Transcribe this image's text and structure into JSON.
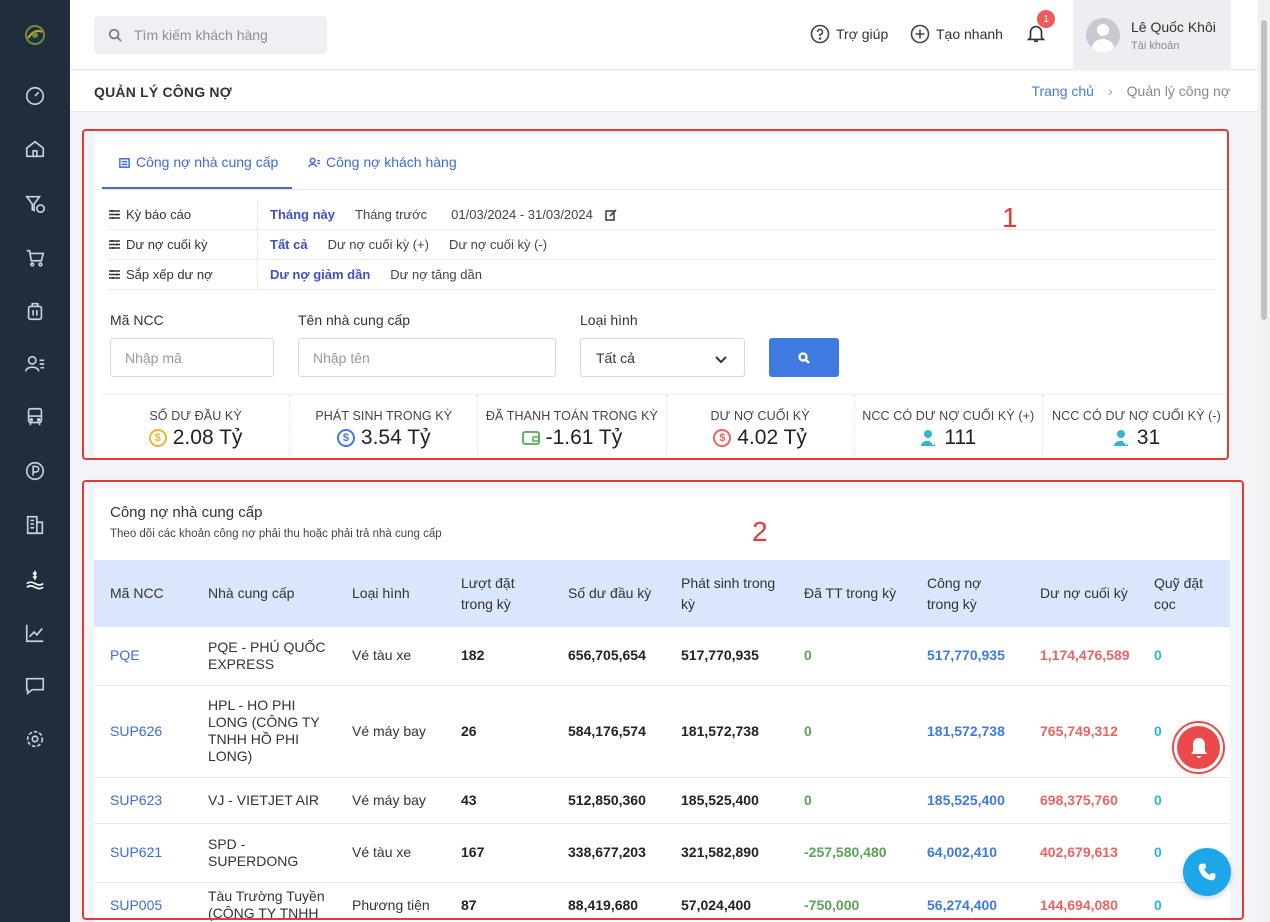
{
  "header": {
    "search_placeholder": "Tìm kiếm khách hàng",
    "help_label": "Trợ giúp",
    "quick_create_label": "Tạo nhanh",
    "notification_count": "1",
    "account_name": "Lê Quốc Khôi",
    "account_sub": "Tài khoản"
  },
  "page": {
    "title": "QUẢN LÝ CÔNG NỢ",
    "breadcrumb_home": "Trang chủ",
    "breadcrumb_sep": "›",
    "breadcrumb_current": "Quản lý công nợ"
  },
  "annotations": {
    "box1": "1",
    "box2": "2"
  },
  "tabs": {
    "supplier": "Công nợ nhà cung cấp",
    "customer": "Công nợ khách hàng"
  },
  "filters": {
    "period": {
      "label": "Kỳ báo cáo",
      "opt1": "Tháng này",
      "opt2": "Tháng trước",
      "range": "01/03/2024 - 31/03/2024"
    },
    "balance": {
      "label": "Dư nợ cuối kỳ",
      "opt1": "Tất cả",
      "opt2": "Dư nợ cuối kỳ (+)",
      "opt3": "Dư nợ cuối kỳ (-)"
    },
    "sort": {
      "label": "Sắp xếp dư nợ",
      "opt1": "Dư nợ giảm dần",
      "opt2": "Dư nợ tăng dần"
    }
  },
  "form": {
    "code_label": "Mã NCC",
    "code_placeholder": "Nhập mã",
    "name_label": "Tên nhà cung cấp",
    "name_placeholder": "Nhập tên",
    "type_label": "Loại hình",
    "type_value": "Tất cả"
  },
  "stats": [
    {
      "label": "SỐ DƯ ĐẦU KỲ",
      "value": "2.08 Tỷ",
      "color": "#f2b233"
    },
    {
      "label": "PHÁT SINH TRONG KỲ",
      "value": "3.54 Tỷ",
      "color": "#3f7ae0"
    },
    {
      "label": "ĐÃ THANH TOÁN TRONG KỲ",
      "value": "-1.61 Tỷ",
      "color": "#4caf50"
    },
    {
      "label": "DƯ NỢ CUỐI KỲ",
      "value": "4.02 Tỷ",
      "color": "#ef6262"
    },
    {
      "label": "NCC CÓ DƯ NỢ CUỐI KỲ (+)",
      "value": "111",
      "color": "#2db6d6"
    },
    {
      "label": "NCC CÓ DƯ NỢ CUỐI KỲ (-)",
      "value": "31",
      "color": "#2db6d6"
    }
  ],
  "table_section": {
    "title": "Công nợ nhà cung cấp",
    "subtitle": "Theo dõi các khoản công nợ phải thu hoặc phải trả nhà cung cấp",
    "columns": [
      "Mã NCC",
      "Nhà cung cấp",
      "Loại hình",
      "Lượt đặt trong kỳ",
      "Số dư đầu kỳ",
      "Phát sinh trong kỳ",
      "Đã TT trong kỳ",
      "Công nợ trong kỳ",
      "Dư nợ cuối kỳ",
      "Quỹ đặt cọc"
    ],
    "rows": [
      [
        "PQE",
        "PQE - PHÚ QUỐC EXPRESS",
        "Vé tàu xe",
        "182",
        "656,705,654",
        "517,770,935",
        "0",
        "517,770,935",
        "1,174,476,589",
        "0"
      ],
      [
        "SUP626",
        "HPL - HO PHI LONG (CÔNG TY TNHH HỒ PHI LONG)",
        "Vé máy bay",
        "26",
        "584,176,574",
        "181,572,738",
        "0",
        "181,572,738",
        "765,749,312",
        "0"
      ],
      [
        "SUP623",
        "VJ - VIETJET AIR",
        "Vé máy bay",
        "43",
        "512,850,360",
        "185,525,400",
        "0",
        "185,525,400",
        "698,375,760",
        "0"
      ],
      [
        "SUP621",
        "SPD - SUPERDONG",
        "Vé tàu xe",
        "167",
        "338,677,203",
        "321,582,890",
        "-257,580,480",
        "64,002,410",
        "402,679,613",
        "0"
      ],
      [
        "SUP005",
        "Tàu Trường Tuyền (CÔNG TY TNHH",
        "Phương tiện",
        "87",
        "88,419,680",
        "57,024,400",
        "-750,000",
        "56,274,400",
        "144,694,080",
        "0"
      ]
    ]
  }
}
